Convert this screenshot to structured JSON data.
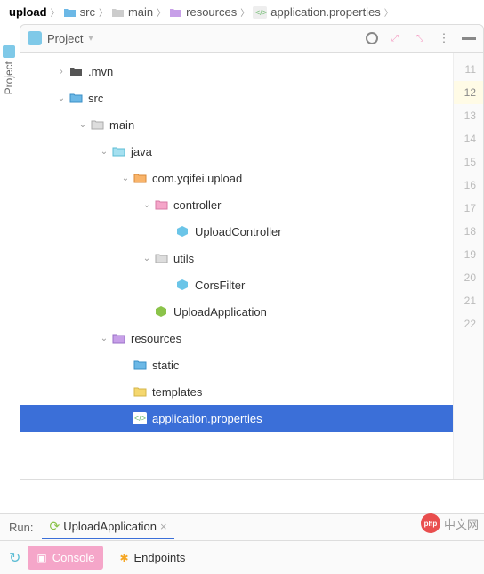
{
  "breadcrumb": {
    "root": "upload",
    "parts": [
      "src",
      "main",
      "resources",
      "application.properties"
    ]
  },
  "toolbar": {
    "project_label": "Project"
  },
  "tree": {
    "mvn": ".mvn",
    "src": "src",
    "main": "main",
    "java": "java",
    "pkg": "com.yqifei.upload",
    "controller": "controller",
    "upload_controller": "UploadController",
    "utils": "utils",
    "cors_filter": "CorsFilter",
    "upload_application": "UploadApplication",
    "resources": "resources",
    "static": "static",
    "templates": "templates",
    "app_props": "application.properties"
  },
  "gutter": {
    "lines": [
      "11",
      "12",
      "13",
      "14",
      "15",
      "16",
      "17",
      "18",
      "19",
      "20",
      "21",
      "22"
    ],
    "highlighted": 1
  },
  "run": {
    "label": "Run:",
    "tab_name": "UploadApplication"
  },
  "bottom": {
    "console": "Console",
    "endpoints": "Endpoints"
  },
  "sidebar_tab": "Project",
  "watermark": {
    "badge": "php",
    "text": "中文网"
  }
}
